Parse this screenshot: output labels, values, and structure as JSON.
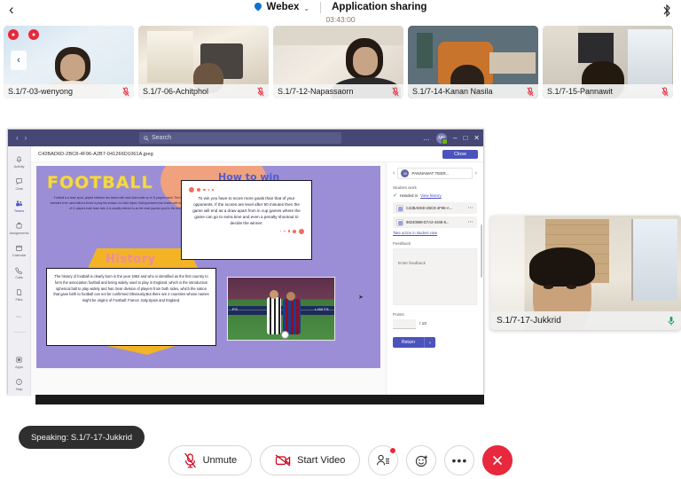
{
  "topbar": {
    "back_icon": "back-chevron-icon",
    "brand": "Webex",
    "brand_caret": "⌄",
    "title": "Application sharing",
    "timer": "03:43:00",
    "bluetooth_icon": "bluetooth-icon"
  },
  "filmstrip": {
    "prev_arrow": "‹",
    "badges": [
      "●",
      "●"
    ],
    "participants": [
      {
        "name": "S.1/7-03-wenyong",
        "muted": true
      },
      {
        "name": "S.1/7-06-Achitphol",
        "muted": true
      },
      {
        "name": "S.1/7-12-Napassaorn",
        "muted": true
      },
      {
        "name": "S.1/7-14-Kanan Nasila",
        "muted": true
      },
      {
        "name": "S.1/7-15-Pannawit",
        "muted": true
      }
    ]
  },
  "shared_app": {
    "titlebar": {
      "nav_back": "‹",
      "nav_forward": "›",
      "search_placeholder": "Search",
      "search_icon": "search-icon",
      "overflow": "…",
      "avatar_initials": "NN",
      "minimize": "–",
      "maximize": "□",
      "close": "✕"
    },
    "rail": [
      {
        "label": "Activity",
        "icon": "bell-icon"
      },
      {
        "label": "Chat",
        "icon": "chat-icon"
      },
      {
        "label": "Teams",
        "icon": "teams-icon",
        "active": true
      },
      {
        "label": "Assignments",
        "icon": "assignments-icon"
      },
      {
        "label": "Calendar",
        "icon": "calendar-icon"
      },
      {
        "label": "Calls",
        "icon": "phone-icon"
      },
      {
        "label": "Files",
        "icon": "file-icon"
      },
      {
        "label": "",
        "icon": "more-icon"
      },
      {
        "label": "Apps",
        "icon": "apps-icon"
      },
      {
        "label": "Help",
        "icon": "help-icon"
      }
    ],
    "document": {
      "filename": "C42BAD6D-2BC8-4F96-A2B7-041266D1061A.jpeg",
      "close_label": "Close"
    },
    "slide": {
      "title": "FOOTBALL",
      "intro": "Football is a team sport, played between two teams with each side made up of 11 players each. The ball is a sphere intended to be used without shoes to play the surface of a field object, finding between two teams with each side made up of 11 players each team side, it is usually referred to as the most popular sport in the world.",
      "how_to_win_heading": "How to win",
      "how_to_win_body": "To win you have to score more goals than that of your opponents. If the scores are level after 90 minutes then the game will end as a draw apart from in cup games where the game can go to extra time and even a penalty shootout to decide the winner.",
      "history_heading": "History",
      "history_body": "The history of football is clearly born in the year 1863 and who is identified as the first country to form the association football and being widely used to play in England ,which is the introduction spherical ball to play widely and has clear division of players from both sides, which the nation that gave birth to football can not be confirmed Obviously,But there are 2 countries whose names might be origins of Football: France ,Italy,Spain and England.",
      "photo_caption": "LIMITS",
      "photo_caption2": "PS"
    },
    "grading": {
      "student_name": "PANNAWAT TEER...",
      "student_initials": "30",
      "prev_student": "‹",
      "next_student": "›",
      "student_work_label": "Student work",
      "handed_in": "Handed in",
      "view_history_link": "View history",
      "files": [
        "C42BAD6D-2BC8-4F96-A...",
        "98240698-D7A2-4348-8..."
      ],
      "take_action_link": "Take action in student view",
      "feedback_label": "Feedback",
      "feedback_placeholder": "Enter feedback",
      "points_label": "Points",
      "points_value": "",
      "points_max": "/ 10",
      "return_label": "Return",
      "return_caret": "⌄"
    }
  },
  "selfview": {
    "name": "S.1/7-17-Jukkrid",
    "mic_icon": "mic-on-icon"
  },
  "speaking": {
    "text": "Speaking: S.1/7-17-Jukkrid"
  },
  "controls": {
    "unmute": {
      "label": "Unmute",
      "icon": "mic-muted-icon"
    },
    "start_video": {
      "label": "Start Video",
      "icon": "camera-off-icon"
    },
    "participants": {
      "icon": "participants-icon",
      "has_badge": true
    },
    "reactions": {
      "icon": "reactions-smiley-icon"
    },
    "more": {
      "icon": "more-horizontal-icon",
      "label": "•••"
    },
    "end": {
      "icon": "end-call-icon",
      "label": "✕"
    }
  },
  "colors": {
    "accent_red": "#e8283c",
    "teams_purple": "#464775",
    "teams_button": "#4b53bc",
    "slide_bg": "#9b8ed6",
    "slide_title": "#f5d94b"
  }
}
